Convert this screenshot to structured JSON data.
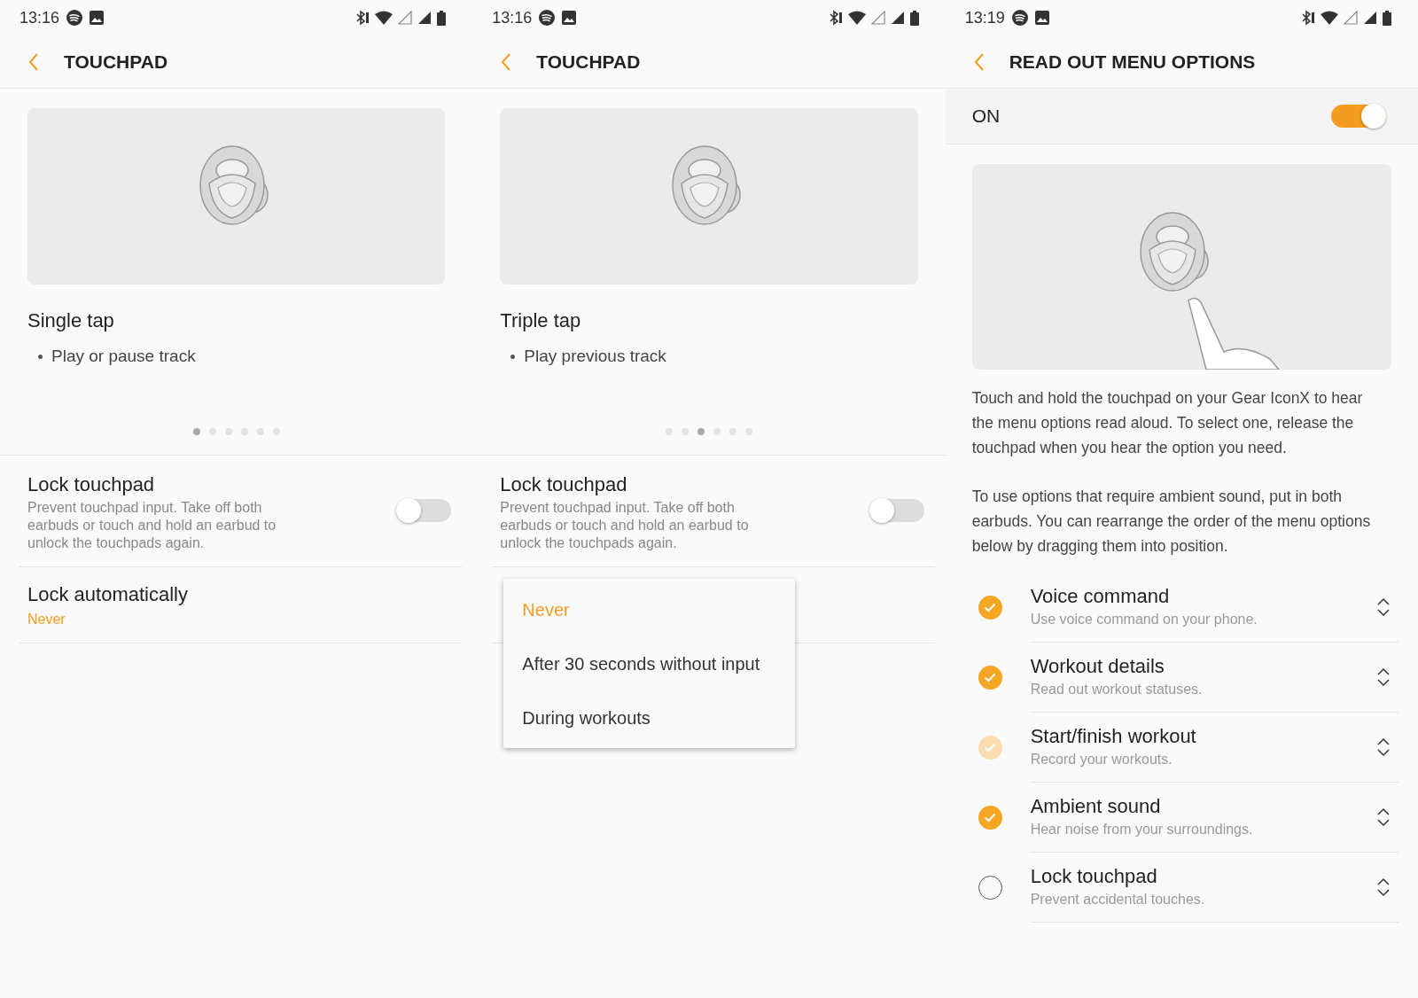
{
  "screens": [
    {
      "kind": "touchpad",
      "status_bar": {
        "time": "13:16"
      },
      "title": "TOUCHPAD",
      "gesture": {
        "title": "Single tap",
        "bullets": [
          "Play or pause track"
        ]
      },
      "page_dots": [
        {
          "selected": true
        },
        {
          "selected": false
        },
        {
          "selected": false
        },
        {
          "selected": false
        },
        {
          "selected": false
        },
        {
          "selected": false
        }
      ],
      "settings": [
        {
          "kind": "switch",
          "title": "Lock touchpad",
          "description": "Prevent touchpad input. Take off both earbuds or touch and hold an earbud to unlock the touchpads again.",
          "on": false
        },
        {
          "kind": "value",
          "title": "Lock automatically",
          "value": "Never"
        }
      ]
    },
    {
      "kind": "touchpad",
      "status_bar": {
        "time": "13:16"
      },
      "title": "TOUCHPAD",
      "gesture": {
        "title": "Triple tap",
        "bullets": [
          "Play previous track"
        ]
      },
      "page_dots": [
        {
          "selected": false
        },
        {
          "selected": false
        },
        {
          "selected": true
        },
        {
          "selected": false
        },
        {
          "selected": false
        },
        {
          "selected": false
        }
      ],
      "settings": [
        {
          "kind": "switch",
          "title": "Lock touchpad",
          "description": "Prevent touchpad input. Take off both earbuds or touch and hold an earbud to unlock the touchpads again.",
          "on": false
        },
        {
          "kind": "covered"
        }
      ],
      "dropdown": {
        "options": [
          {
            "label": "Never",
            "selected": true
          },
          {
            "label": "After 30 seconds without input",
            "selected": false
          },
          {
            "label": "During workouts",
            "selected": false
          }
        ]
      }
    },
    {
      "kind": "read_out",
      "status_bar": {
        "time": "13:19"
      },
      "title": "READ OUT MENU OPTIONS",
      "master": {
        "label": "ON",
        "on": true
      },
      "paragraphs": [
        "Touch and hold the touchpad on your Gear IconX to hear the menu options read aloud. To select one, release the touchpad when you hear the option you need.",
        "To use options that require ambient sound, put in both earbuds. You can rearrange the order of the menu options below by dragging them into position."
      ],
      "options": [
        {
          "title": "Voice command",
          "description": "Use voice command on your phone.",
          "checked": true,
          "disabled": false
        },
        {
          "title": "Workout details",
          "description": "Read out workout statuses.",
          "checked": true,
          "disabled": false
        },
        {
          "title": "Start/finish workout",
          "description": "Record your workouts.",
          "checked": true,
          "disabled": true
        },
        {
          "title": "Ambient sound",
          "description": "Hear noise from your surroundings.",
          "checked": true,
          "disabled": false
        },
        {
          "title": "Lock touchpad",
          "description": "Prevent accidental touches.",
          "checked": false,
          "disabled": false
        }
      ]
    }
  ]
}
